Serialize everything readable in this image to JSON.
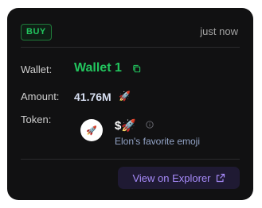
{
  "badge": {
    "label": "BUY"
  },
  "header": {
    "time": "just now"
  },
  "wallet": {
    "label": "Wallet:",
    "name": "Wallet 1",
    "copy_icon": "copy-icon"
  },
  "amount": {
    "label": "Amount:",
    "value": "41.76M",
    "icon": "🚀"
  },
  "token": {
    "label": "Token:",
    "avatar": "🚀",
    "symbol": "$🚀",
    "name": "Elon's favorite emoji",
    "info_icon": "info-icon"
  },
  "explorer": {
    "label": "View on Explorer",
    "icon": "external-link-icon"
  },
  "colors": {
    "card_bg": "#111112",
    "accent_green": "#22c55e",
    "accent_purple": "#a78bfa"
  }
}
